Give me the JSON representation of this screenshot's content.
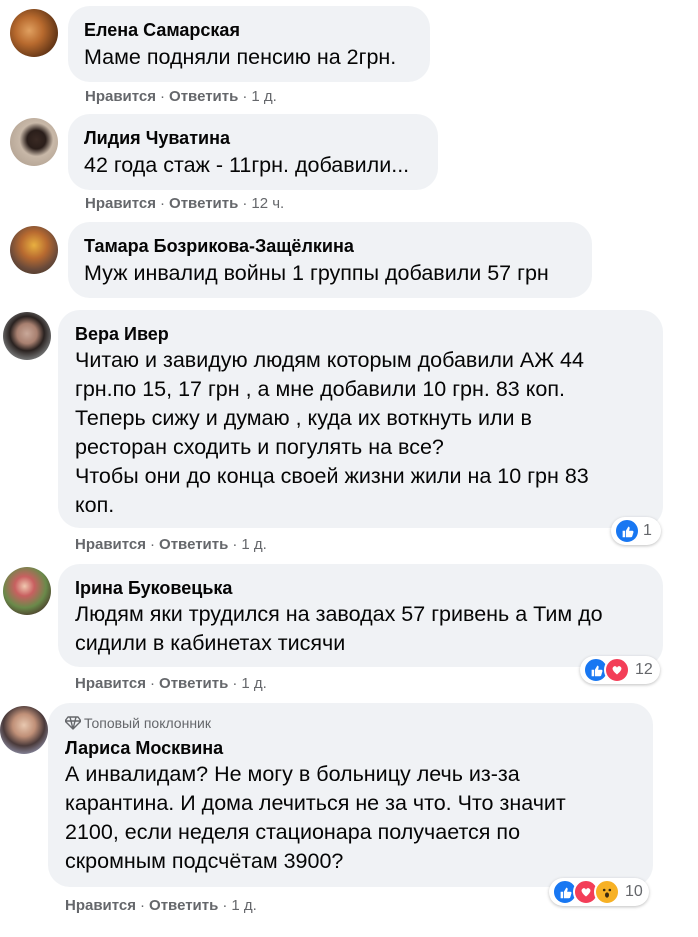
{
  "actions": {
    "like_label": "Нравится",
    "reply_label": "Ответить"
  },
  "comments": [
    {
      "author": "Елена Самарская",
      "text": "Маме подняли пенсию на 2грн.",
      "time": "1 д."
    },
    {
      "author": "Лидия Чуватина",
      "text": "42 года стаж - 11грн. добавили...",
      "time": "12 ч."
    },
    {
      "author": "Тамара Бозрикова-Защёлкина",
      "text": "Муж инвалид войны 1 группы добавили 57 грн",
      "time": ""
    },
    {
      "author": "Вера Ивер",
      "text": "Читаю и завидую людям которым добавили АЖ 44\nгрн.по 15, 17 грн , а мне добавили 10 грн. 83 коп.\nТеперь сижу и думаю , куда их воткнуть или в\nресторан сходить и погулять на все?\nЧтобы они до конца своей жизни жили на 10 грн 83\nкоп.",
      "time": "1 д.",
      "reaction_count": "1",
      "reactions": [
        "like"
      ]
    },
    {
      "author": "Ірина Буковецька",
      "text": "Людям яки трудился на заводах 57 гривень а Тим до\nсидили в кабинетах тисячи",
      "time": "1 д.",
      "reaction_count": "12",
      "reactions": [
        "like",
        "love"
      ]
    },
    {
      "badge": "Топовый поклонник",
      "author": "Лариса Москвина",
      "text": "А инвалидам? Не могу в больницу лечь из-за\nкарантина. И дома лечиться не за что. Что значит\n2100, если неделя стационара получается по\nскромным подсчётам 3900?",
      "time": "1 д.",
      "reaction_count": "10",
      "reactions": [
        "like",
        "love",
        "wow"
      ]
    }
  ],
  "colors": {
    "bubble": "#f0f2f5",
    "muted": "#65676b",
    "like": "#1877f2",
    "love": "#f33e58",
    "wow": "#f7b125"
  }
}
